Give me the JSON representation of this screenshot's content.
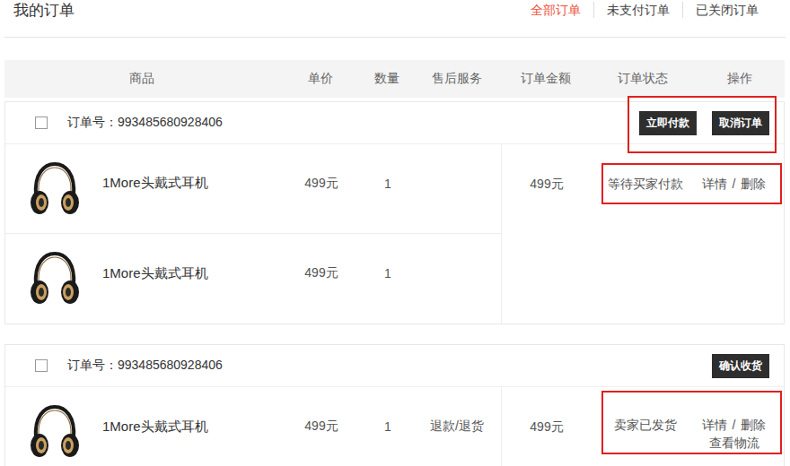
{
  "page": {
    "title": "我的订单"
  },
  "tabs": [
    {
      "label": "全部订单",
      "selected": true
    },
    {
      "label": "未支付订单",
      "selected": false
    },
    {
      "label": "已关闭订单",
      "selected": false
    }
  ],
  "table": {
    "columns": [
      "商品",
      "单价",
      "数量",
      "售后服务",
      "订单金额",
      "订单状态",
      "操作"
    ]
  },
  "orders": [
    {
      "checked": false,
      "order_no": "订单号：993485680928406",
      "buttons": [
        "立即付款",
        "取消订单"
      ],
      "buttons_highlighted": true,
      "items": [
        {
          "name": "1More头戴式耳机",
          "price": "499元",
          "quantity": "1",
          "after_sale": ""
        },
        {
          "name": "1More头戴式耳机",
          "price": "499元",
          "quantity": "1",
          "after_sale": ""
        }
      ],
      "amount": "499元",
      "status": "等待买家付款",
      "status_highlighted": true,
      "actions": [
        "详情",
        "删除"
      ],
      "action_separator": "/",
      "extra_actions": []
    },
    {
      "checked": false,
      "order_no": "订单号：993485680928406",
      "buttons": [
        "确认收货"
      ],
      "buttons_highlighted": false,
      "items": [
        {
          "name": "1More头戴式耳机",
          "price": "499元",
          "quantity": "1",
          "after_sale": "退款/退货"
        }
      ],
      "amount": "499元",
      "status": "卖家已发货",
      "status_highlighted": true,
      "actions": [
        "详情",
        "删除"
      ],
      "action_separator": "/",
      "extra_actions": [
        "查看物流"
      ]
    }
  ]
}
